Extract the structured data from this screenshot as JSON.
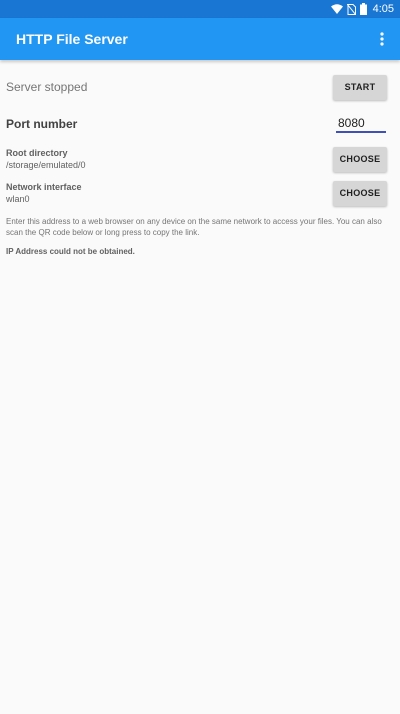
{
  "status_bar": {
    "time": "4:05",
    "icons": [
      "wifi-icon",
      "no-sim-icon",
      "battery-icon"
    ]
  },
  "app_bar": {
    "title": "HTTP File Server",
    "overflow_icon": "more-vert-icon",
    "color": "#2196f3"
  },
  "server": {
    "status": "Server stopped",
    "start_label": "START"
  },
  "port": {
    "label": "Port number",
    "value": "8080"
  },
  "root_directory": {
    "label": "Root directory",
    "value": "/storage/emulated/0",
    "button_label": "CHOOSE"
  },
  "network_interface": {
    "label": "Network interface",
    "value": "wlan0",
    "button_label": "CHOOSE"
  },
  "help_text": "Enter this address to a web browser on any device on the same network to access your files. You can also scan the QR code below or long press to copy the link.",
  "ip_text": "IP Address could not be obtained."
}
